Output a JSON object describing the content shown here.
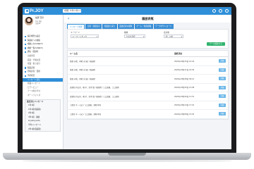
{
  "app": {
    "logo_text": "Pr.JOY",
    "account_select": "1期間（1年×1年)",
    "brand_color": "#2f8fd8"
  },
  "profile": {
    "name": "佐野 花奈",
    "meta_line1": "1年 1組",
    "meta_line2": "生徒ID"
  },
  "sidebar": {
    "items": [
      {
        "label": "保存場所の設定",
        "type": "item"
      },
      {
        "label": "保護者への連絡",
        "type": "item"
      },
      {
        "label": "成績入力(SUNJOY)",
        "type": "item"
      },
      {
        "label": "成績一覧(SUNJOY)",
        "type": "item"
      },
      {
        "label": "通知・面接時",
        "type": "item"
      },
      {
        "label": "出席状況",
        "type": "sub"
      },
      {
        "label": "面接・行動計画",
        "type": "sub"
      },
      {
        "label": "授業・振り返り",
        "type": "sub"
      },
      {
        "label": "授業記録",
        "type": "item"
      },
      {
        "label": "行動計画・目標",
        "type": "item"
      },
      {
        "label": "学習状況",
        "type": "item"
      },
      {
        "label": "メッセージ送信",
        "type": "active"
      },
      {
        "label": "授業メッセージ",
        "type": "sub"
      },
      {
        "label": "ピアレビュー",
        "type": "sub"
      },
      {
        "label": "テーマ別の学び",
        "type": "sub"
      },
      {
        "label": "ポートフォリオ",
        "type": "sub"
      }
    ],
    "box_title": "最近見たメッセージ",
    "box_items": [
      "1年1組",
      "1年1組(保護者)",
      "2年1組",
      "3年1組 - 連絡",
      "kuyakuyushu",
      "学年メッセージ",
      "2年1組(保護者)"
    ]
  },
  "main": {
    "page_title": "履歴表覧",
    "tabs": [
      "メッセージ管理",
      "日報・週報表示",
      "授業振り返り",
      "面談記録の閲覧",
      "ゲーム・動画視聴",
      "データダウンロード"
    ],
    "active_tab": 0,
    "filters": [
      {
        "label": "キーワード",
        "value": "キーワードを入力"
      },
      {
        "label": "種類",
        "value": "全員を選択"
      },
      {
        "label": "表示順",
        "value": "新しい順"
      }
    ],
    "filter_button": "データ更新する",
    "table": {
      "headers": [
        "ルーム名",
        "最終送信",
        ""
      ],
      "rows": [
        {
          "room": "佐藤 水嶋、中嶋 光(母) / 龍瑞院",
          "date": "2024年04月15日 10:44",
          "action": "詳細"
        },
        {
          "room": "佐藤 水嶋、中嶋 光(母) / 龍瑞院",
          "date": "2024年04月11日 16:30",
          "action": "詳細"
        },
        {
          "room": "佐藤 水嶋、中嶋 光(母) / 龍瑞院",
          "date": "2024年03月28日 09:12",
          "action": "詳細"
        },
        {
          "room": "近藤和 内山亮、増 手、鈴木 慎 / 龍瑞院 / 工口英樹、工口技術",
          "date": "2024年03月25日 14:08",
          "action": "詳細"
        },
        {
          "room": "近藤和 内山亮、増 手、鈴木 慎 / 龍瑞院 / 工口英樹、工口技術",
          "date": "2024年03月20日 11:51",
          "action": "詳細"
        },
        {
          "room": "工藤正 千 一(父) / 工口英樹、須賀 伸吾",
          "date": "2024年03月14日 17:22",
          "action": "詳細"
        },
        {
          "room": "工藤正 千 一(父) / 工口英樹、須賀 伸吾",
          "date": "2024年03月08日 15:03",
          "action": "詳細"
        }
      ]
    }
  }
}
